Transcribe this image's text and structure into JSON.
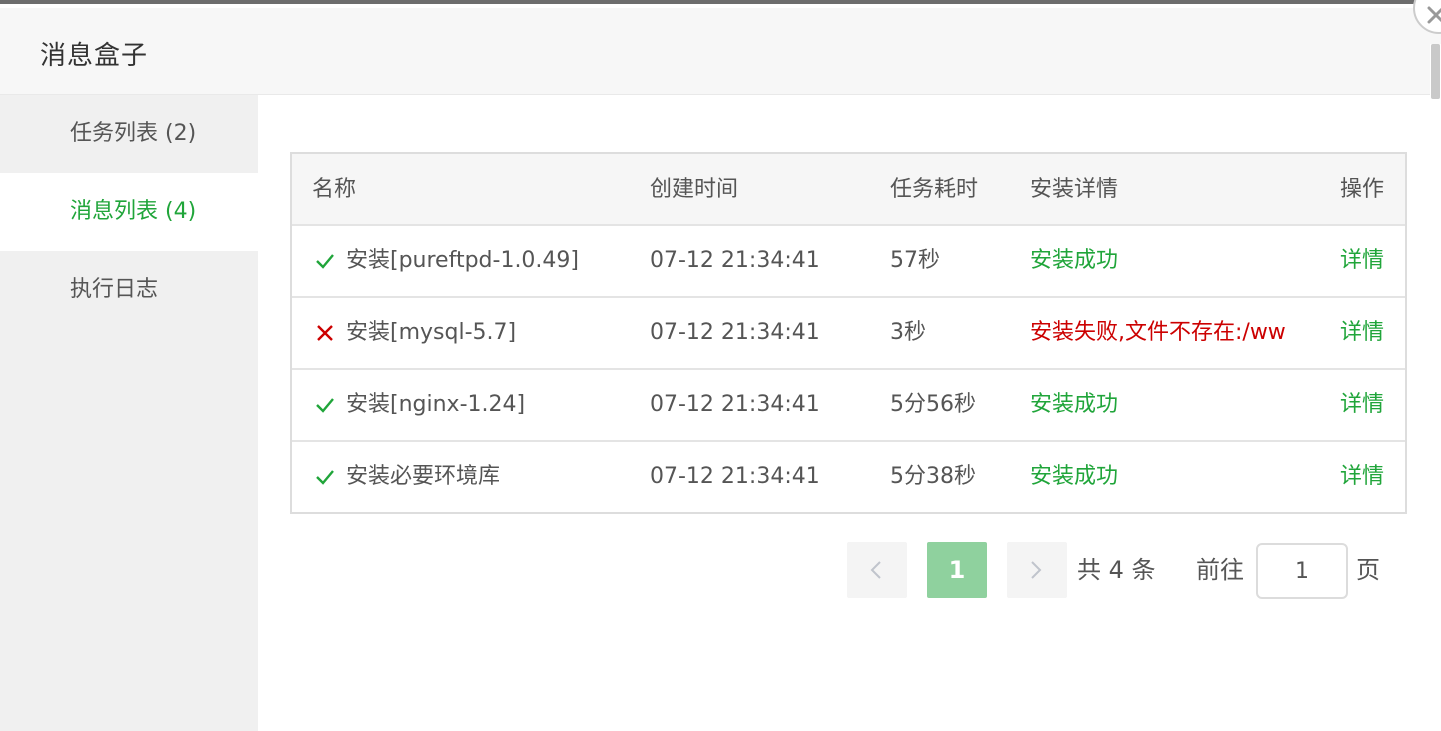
{
  "dialog": {
    "title": "消息盒子"
  },
  "sidebar": {
    "items": [
      {
        "label": "任务列表 (2)",
        "active": false
      },
      {
        "label": "消息列表 (4)",
        "active": true
      },
      {
        "label": "执行日志",
        "active": false
      }
    ]
  },
  "table": {
    "headers": {
      "name": "名称",
      "created": "创建时间",
      "duration": "任务耗时",
      "detail": "安装详情",
      "action": "操作"
    },
    "rows": [
      {
        "status": "success",
        "status_icon": "check-icon",
        "name": "安装[pureftpd-1.0.49]",
        "created": "07-12 21:34:41",
        "duration": "57秒",
        "detail": "安装成功",
        "action": "详情"
      },
      {
        "status": "failure",
        "status_icon": "cross-icon",
        "name": "安装[mysql-5.7]",
        "created": "07-12 21:34:41",
        "duration": "3秒",
        "detail": "安装失败,文件不存在:/ww",
        "action": "详情"
      },
      {
        "status": "success",
        "status_icon": "check-icon",
        "name": "安装[nginx-1.24]",
        "created": "07-12 21:34:41",
        "duration": "5分56秒",
        "detail": "安装成功",
        "action": "详情"
      },
      {
        "status": "success",
        "status_icon": "check-icon",
        "name": "安装必要环境库",
        "created": "07-12 21:34:41",
        "duration": "5分38秒",
        "detail": "安装成功",
        "action": "详情"
      }
    ]
  },
  "pagination": {
    "current_page": "1",
    "total_text": "共 4 条",
    "goto_label": "前往",
    "goto_value": "1",
    "page_suffix": "页"
  },
  "colors": {
    "accent": "#20a53a",
    "error": "#cc0000",
    "active_page_bg": "#8fd19e"
  }
}
